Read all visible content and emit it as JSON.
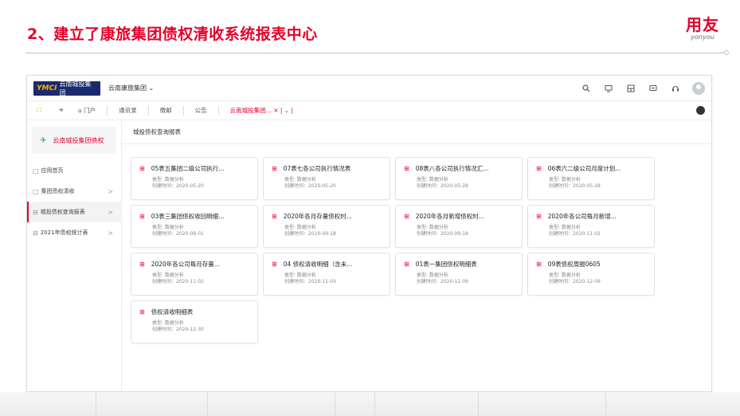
{
  "slide": {
    "title": "2、建立了康旅集团债权清收系统报表中心",
    "brand_cn": "用友",
    "brand_en": "yonyou",
    "accent_color": "#e4002b"
  },
  "topbar": {
    "logo_text": "云南城投集团",
    "logo_mark": "YMCI",
    "org_select": "云南康旅集团 ⌄",
    "icons": [
      "search-icon",
      "monitor-icon",
      "grid-icon",
      "message-icon",
      "headset-icon",
      "user-avatar"
    ]
  },
  "tabbar": {
    "home": "门户",
    "tabs": [
      "通讯录",
      "微邮",
      "公告"
    ],
    "active_tab": "云南城投集团... × | ⌄ |"
  },
  "sidebar": {
    "header": "云南城投集团债权",
    "items": [
      {
        "label": "应用首页",
        "arrow": ""
      },
      {
        "label": "集团债权清收",
        "arrow": ">"
      },
      {
        "label": "城投债权查询报表",
        "arrow": ">"
      },
      {
        "label": "2021年债权统计表",
        "arrow": ">"
      }
    ]
  },
  "main": {
    "header": "城投债权查询报表",
    "cards": [
      {
        "title": "05表五集团二级公司执行...",
        "type": "类型: 数据分析",
        "date": "创建时间：2020-05-20"
      },
      {
        "title": "07表七各公司执行情况表",
        "type": "类型: 数据分析",
        "date": "创建时间：2020-05-20"
      },
      {
        "title": "08表八各公司执行情况汇...",
        "type": "类型: 数据分析",
        "date": "创建时间：2020-05-28"
      },
      {
        "title": "06表六二级公司月度计划...",
        "type": "类型: 数据分析",
        "date": "创建时间：2020-05-28"
      },
      {
        "title": "03表三集团债权收回明细...",
        "type": "类型: 数据分析",
        "date": "创建时间：2020-08-01"
      },
      {
        "title": "2020年各月存量债权时...",
        "type": "类型: 数据分析",
        "date": "创建时间：2020-09-18"
      },
      {
        "title": "2020年各月新增债权时...",
        "type": "类型: 数据分析",
        "date": "创建时间：2020-09-18"
      },
      {
        "title": "2020年各公司每月新增...",
        "type": "类型: 数据分析",
        "date": "创建时间：2020-11-02"
      },
      {
        "title": "2020年各公司每月存量...",
        "type": "类型: 数据分析",
        "date": "创建时间：2020-11-02"
      },
      {
        "title": "04 债权清收明细（含未...",
        "type": "类型: 数据分析",
        "date": "创建时间：2020-11-03"
      },
      {
        "title": "01表一集团债权明细表",
        "type": "类型: 数据分析",
        "date": "创建时间：2020-12-09"
      },
      {
        "title": "09表债权周报0605",
        "type": "类型: 数据分析",
        "date": "创建时间：2020-12-09"
      },
      {
        "title": "债权清收明细表",
        "type": "类型: 数据分析",
        "date": "创建时间：2020-12-30"
      }
    ]
  }
}
